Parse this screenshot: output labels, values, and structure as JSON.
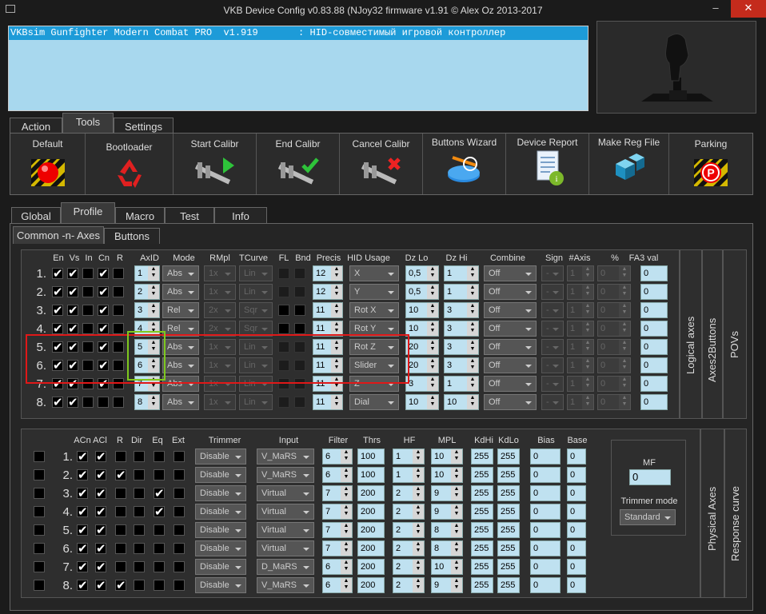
{
  "window": {
    "title": "VKB Device Config v0.83.88 (NJoy32 firmware v1.91 © Alex Oz 2013-2017",
    "min": "–",
    "max": "□",
    "close": "✕"
  },
  "device": {
    "line": "VKBsim Gunfighter Modern Combat PRO  v1.919       : HID-совместимый игровой контроллер"
  },
  "main_tabs": [
    "Action",
    "Tools",
    "Settings"
  ],
  "tools": [
    "Default",
    "Bootloader",
    "Start Calibr",
    "End Calibr",
    "Cancel Calibr",
    "Buttons Wizard",
    "Device Report",
    "Make Reg File",
    "Parking"
  ],
  "profile_tabs": [
    "Global",
    "Profile",
    "Macro",
    "Test",
    "Info"
  ],
  "sub_tabs": [
    "Common -n- Axes",
    "Buttons"
  ],
  "logical": {
    "headers": [
      "En",
      "Vs",
      "In",
      "Cn",
      "R",
      "AxID",
      "Mode",
      "RMpl",
      "TCurve",
      "FL",
      "Bnd",
      "Precis",
      "HID Usage",
      "Dz Lo",
      "Dz Hi",
      "Combine",
      "Sign",
      "#Axis",
      "%",
      "FA3 val"
    ],
    "rows": [
      {
        "n": "1.",
        "en": true,
        "vs": true,
        "in": false,
        "cn": true,
        "r": false,
        "axid": "1",
        "mode": "Abs",
        "rmpl": "1x",
        "tcurve": "Lin",
        "fl": false,
        "bnd": false,
        "precis": "12",
        "usage": "X",
        "dzlo": "0,5",
        "dzhi": "1",
        "combine": "Off",
        "sign": "-",
        "axis": "1",
        "pct": "0",
        "fa3": "0"
      },
      {
        "n": "2.",
        "en": true,
        "vs": true,
        "in": false,
        "cn": true,
        "r": false,
        "axid": "2",
        "mode": "Abs",
        "rmpl": "1x",
        "tcurve": "Lin",
        "fl": false,
        "bnd": false,
        "precis": "12",
        "usage": "Y",
        "dzlo": "0,5",
        "dzhi": "1",
        "combine": "Off",
        "sign": "-",
        "axis": "1",
        "pct": "0",
        "fa3": "0"
      },
      {
        "n": "3.",
        "en": true,
        "vs": true,
        "in": false,
        "cn": true,
        "r": false,
        "axid": "3",
        "mode": "Rel",
        "rmpl": "2x",
        "tcurve": "Sqr",
        "fl": true,
        "bnd": true,
        "precis": "11",
        "usage": "Rot X",
        "dzlo": "10",
        "dzhi": "3",
        "combine": "Off",
        "sign": "-",
        "axis": "1",
        "pct": "0",
        "fa3": "0"
      },
      {
        "n": "4.",
        "en": true,
        "vs": true,
        "in": false,
        "cn": true,
        "r": false,
        "axid": "4",
        "mode": "Rel",
        "rmpl": "2x",
        "tcurve": "Sqr",
        "fl": true,
        "bnd": true,
        "precis": "11",
        "usage": "Rot Y",
        "dzlo": "10",
        "dzhi": "3",
        "combine": "Off",
        "sign": "-",
        "axis": "1",
        "pct": "0",
        "fa3": "0"
      },
      {
        "n": "5.",
        "en": true,
        "vs": true,
        "in": false,
        "cn": true,
        "r": false,
        "axid": "5",
        "mode": "Abs",
        "rmpl": "1x",
        "tcurve": "Lin",
        "fl": false,
        "bnd": false,
        "precis": "11",
        "usage": "Rot Z",
        "dzlo": "20",
        "dzhi": "3",
        "combine": "Off",
        "sign": "-",
        "axis": "1",
        "pct": "0",
        "fa3": "0"
      },
      {
        "n": "6.",
        "en": true,
        "vs": true,
        "in": false,
        "cn": true,
        "r": false,
        "axid": "6",
        "mode": "Abs",
        "rmpl": "1x",
        "tcurve": "Lin",
        "fl": false,
        "bnd": false,
        "precis": "11",
        "usage": "Slider",
        "dzlo": "20",
        "dzhi": "3",
        "combine": "Off",
        "sign": "-",
        "axis": "1",
        "pct": "0",
        "fa3": "0"
      },
      {
        "n": "7.",
        "en": true,
        "vs": true,
        "in": false,
        "cn": true,
        "r": false,
        "axid": "7",
        "mode": "Abs",
        "rmpl": "1x",
        "tcurve": "Lin",
        "fl": false,
        "bnd": false,
        "precis": "11",
        "usage": "Z",
        "dzlo": "3",
        "dzhi": "1",
        "combine": "Off",
        "sign": "-",
        "axis": "1",
        "pct": "0",
        "fa3": "0"
      },
      {
        "n": "8.",
        "en": true,
        "vs": true,
        "in": false,
        "cn": false,
        "r": false,
        "axid": "8",
        "mode": "Abs",
        "rmpl": "1x",
        "tcurve": "Lin",
        "fl": false,
        "bnd": false,
        "precis": "11",
        "usage": "Dial",
        "dzlo": "10",
        "dzhi": "10",
        "combine": "Off",
        "sign": "-",
        "axis": "1",
        "pct": "0",
        "fa3": "0"
      }
    ],
    "side_tabs": [
      "Logical axes",
      "Axes2Buttons",
      "POVs"
    ]
  },
  "physical": {
    "headers": [
      "ACn",
      "ACl",
      "R",
      "Dir",
      "Eq",
      "Ext",
      "Trimmer",
      "Input",
      "Filter",
      "Thrs",
      "HF",
      "MPL",
      "KdHi",
      "KdLo",
      "Bias",
      "Base"
    ],
    "rows": [
      {
        "n": "1.",
        "acn": true,
        "acl": true,
        "r": false,
        "dir": false,
        "eq": false,
        "ext": false,
        "trimmer": "Disable",
        "input": "V_MaRS",
        "filter": "6",
        "thrs": "100",
        "hf": "1",
        "mpl": "10",
        "kdhi": "255",
        "kdlo": "255",
        "bias": "0",
        "base": "0"
      },
      {
        "n": "2.",
        "acn": true,
        "acl": true,
        "r": true,
        "dir": false,
        "eq": false,
        "ext": false,
        "trimmer": "Disable",
        "input": "V_MaRS",
        "filter": "6",
        "thrs": "100",
        "hf": "1",
        "mpl": "10",
        "kdhi": "255",
        "kdlo": "255",
        "bias": "0",
        "base": "0"
      },
      {
        "n": "3.",
        "acn": true,
        "acl": true,
        "r": false,
        "dir": false,
        "eq": true,
        "ext": false,
        "trimmer": "Disable",
        "input": "Virtual",
        "filter": "7",
        "thrs": "200",
        "hf": "2",
        "mpl": "9",
        "kdhi": "255",
        "kdlo": "255",
        "bias": "0",
        "base": "0"
      },
      {
        "n": "4.",
        "acn": true,
        "acl": true,
        "r": false,
        "dir": false,
        "eq": true,
        "ext": false,
        "trimmer": "Disable",
        "input": "Virtual",
        "filter": "7",
        "thrs": "200",
        "hf": "2",
        "mpl": "9",
        "kdhi": "255",
        "kdlo": "255",
        "bias": "0",
        "base": "0"
      },
      {
        "n": "5.",
        "acn": true,
        "acl": true,
        "r": false,
        "dir": false,
        "eq": false,
        "ext": false,
        "trimmer": "Disable",
        "input": "Virtual",
        "filter": "7",
        "thrs": "200",
        "hf": "2",
        "mpl": "8",
        "kdhi": "255",
        "kdlo": "255",
        "bias": "0",
        "base": "0"
      },
      {
        "n": "6.",
        "acn": true,
        "acl": true,
        "r": false,
        "dir": false,
        "eq": false,
        "ext": false,
        "trimmer": "Disable",
        "input": "Virtual",
        "filter": "7",
        "thrs": "200",
        "hf": "2",
        "mpl": "8",
        "kdhi": "255",
        "kdlo": "255",
        "bias": "0",
        "base": "0"
      },
      {
        "n": "7.",
        "acn": true,
        "acl": true,
        "r": false,
        "dir": false,
        "eq": false,
        "ext": false,
        "trimmer": "Disable",
        "input": "D_MaRS",
        "filter": "6",
        "thrs": "200",
        "hf": "2",
        "mpl": "10",
        "kdhi": "255",
        "kdlo": "255",
        "bias": "0",
        "base": "0"
      },
      {
        "n": "8.",
        "acn": true,
        "acl": true,
        "r": true,
        "dir": false,
        "eq": false,
        "ext": false,
        "trimmer": "Disable",
        "input": "V_MaRS",
        "filter": "6",
        "thrs": "200",
        "hf": "2",
        "mpl": "9",
        "kdhi": "255",
        "kdlo": "255",
        "bias": "0",
        "base": "0"
      }
    ],
    "mf_label": "MF",
    "mf_value": "0",
    "trimmer_mode_label": "Trimmer mode",
    "trimmer_mode": "Standard",
    "side_tabs": [
      "Physical Axes",
      "Response curve"
    ]
  },
  "colors": {
    "highlight_red": "#e01818",
    "highlight_green": "#7ec81e",
    "accent": "#1d9bd8"
  }
}
